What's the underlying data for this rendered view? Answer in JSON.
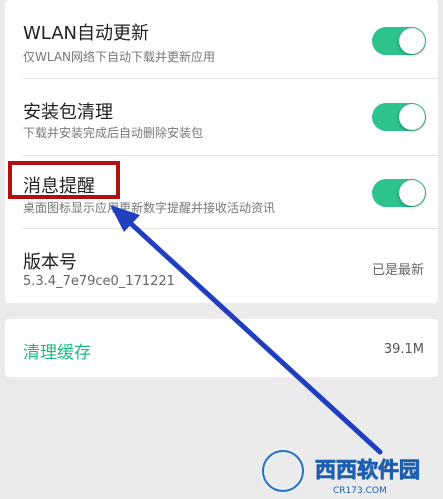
{
  "settings": [
    {
      "title": "WLAN自动更新",
      "subtitle": "仅WLAN网络下自动下载并更新应用",
      "toggle_on": true
    },
    {
      "title": "安装包清理",
      "subtitle": "下载并安装完成后自动删除安装包",
      "toggle_on": true
    },
    {
      "title": "消息提醒",
      "subtitle": "桌面图标显示应用更新数字提醒并接收活动资讯",
      "toggle_on": true
    }
  ],
  "version": {
    "title": "版本号",
    "value": "5.3.4_7e79ce0_171221",
    "status": "已是最新"
  },
  "cache": {
    "label": "清理缓存",
    "size": "39.1M"
  },
  "watermark": {
    "brand": "西西软件园",
    "url": "CR173.COM"
  },
  "colors": {
    "toggle_on": "#2ec28c",
    "cache_label": "#1fb988",
    "highlight": "#b30f0f",
    "arrow": "#1f3fbf"
  }
}
